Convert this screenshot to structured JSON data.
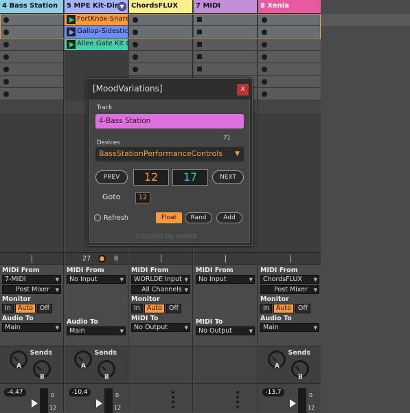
{
  "tracks": [
    {
      "name": "4 Bass Station",
      "color": "#8fd0e8",
      "slots": [
        "stop",
        "stop",
        "stop",
        "stop",
        "stop",
        "stop",
        "stop"
      ],
      "midi_from": "7-MIDI",
      "midi_from_sub": "Post Mixer",
      "monitor_active": "Auto",
      "to_label": "Audio To",
      "to_value": "Main",
      "volume": "-4.47",
      "show_monitor": true
    },
    {
      "name": "5 MPE Kit-Dire",
      "color": "#a6b2f5",
      "slots": [],
      "midi_from": "No Input",
      "midi_from_sub": "",
      "monitor_active": "",
      "to_label": "Audio To",
      "to_value": "Main",
      "volume": "-10.4",
      "show_monitor": false
    },
    {
      "name": "ChordsFLUX",
      "color": "#f8f088",
      "slots": [
        "stop",
        "stop",
        "stop",
        "stop",
        "stop",
        "stop",
        "stop"
      ],
      "midi_from": "WORLDE Input",
      "midi_from_sub": "All Channels",
      "monitor_active": "Auto",
      "to_label": "MIDI To",
      "to_value": "No Output",
      "volume": "",
      "show_monitor": true
    },
    {
      "name": "7 MIDI",
      "color": "#c08fd8",
      "slots": [
        "sq",
        "sq",
        "sq",
        "sq",
        "sq",
        "sq",
        "sq"
      ],
      "midi_from": "No Input",
      "midi_from_sub": "",
      "monitor_active": "",
      "to_label": "MIDI To",
      "to_value": "No Output",
      "volume": "",
      "show_monitor": false
    },
    {
      "name": "8 Xenia",
      "color": "#e85aa0",
      "slots": [
        "stop",
        "stop",
        "stop",
        "stop",
        "stop",
        "stop",
        "stop"
      ],
      "midi_from": "ChordsFLUX",
      "midi_from_sub": "Post Mixer",
      "monitor_active": "Auto",
      "to_label": "Audio To",
      "to_value": "Main",
      "volume": "-13.7",
      "show_monitor": true
    }
  ],
  "clips": [
    {
      "label": "FortKnox-Snare",
      "color": "#ff9a3c",
      "icon": "play"
    },
    {
      "label": "Gallop-Sidestick",
      "color": "#6d8cff",
      "icon": "play-blue"
    },
    {
      "label": "Allee Gate Kit C",
      "color": "#46d0b0",
      "icon": "play"
    }
  ],
  "labels": {
    "midi_from": "MIDI From",
    "monitor": "Monitor",
    "mon_in": "In",
    "mon_auto": "Auto",
    "mon_off": "Off",
    "sends": "Sends",
    "knob_a": "A",
    "knob_b": "B",
    "meter_top": "0",
    "meter_bottom": "12"
  },
  "track2_activator": {
    "left": "27",
    "right": "8"
  },
  "plugin": {
    "title": "[MoodVariations]",
    "close": "x",
    "track_label": "Track",
    "track_value": "4-Bass Station",
    "devices_label": "Devices",
    "devices_count": "71",
    "device_value": "BassStationPerformanceControls",
    "prev": "PREV",
    "next": "NEXT",
    "current": "12",
    "total": "17",
    "goto_label": "Goto",
    "goto_value": "12",
    "refresh": "Refresh",
    "float": "Float",
    "rand": "Rand",
    "add": "Add",
    "credit": "created by swina",
    "accent_orange": "#ff9a3c",
    "accent_cyan": "#2ec8d8"
  }
}
